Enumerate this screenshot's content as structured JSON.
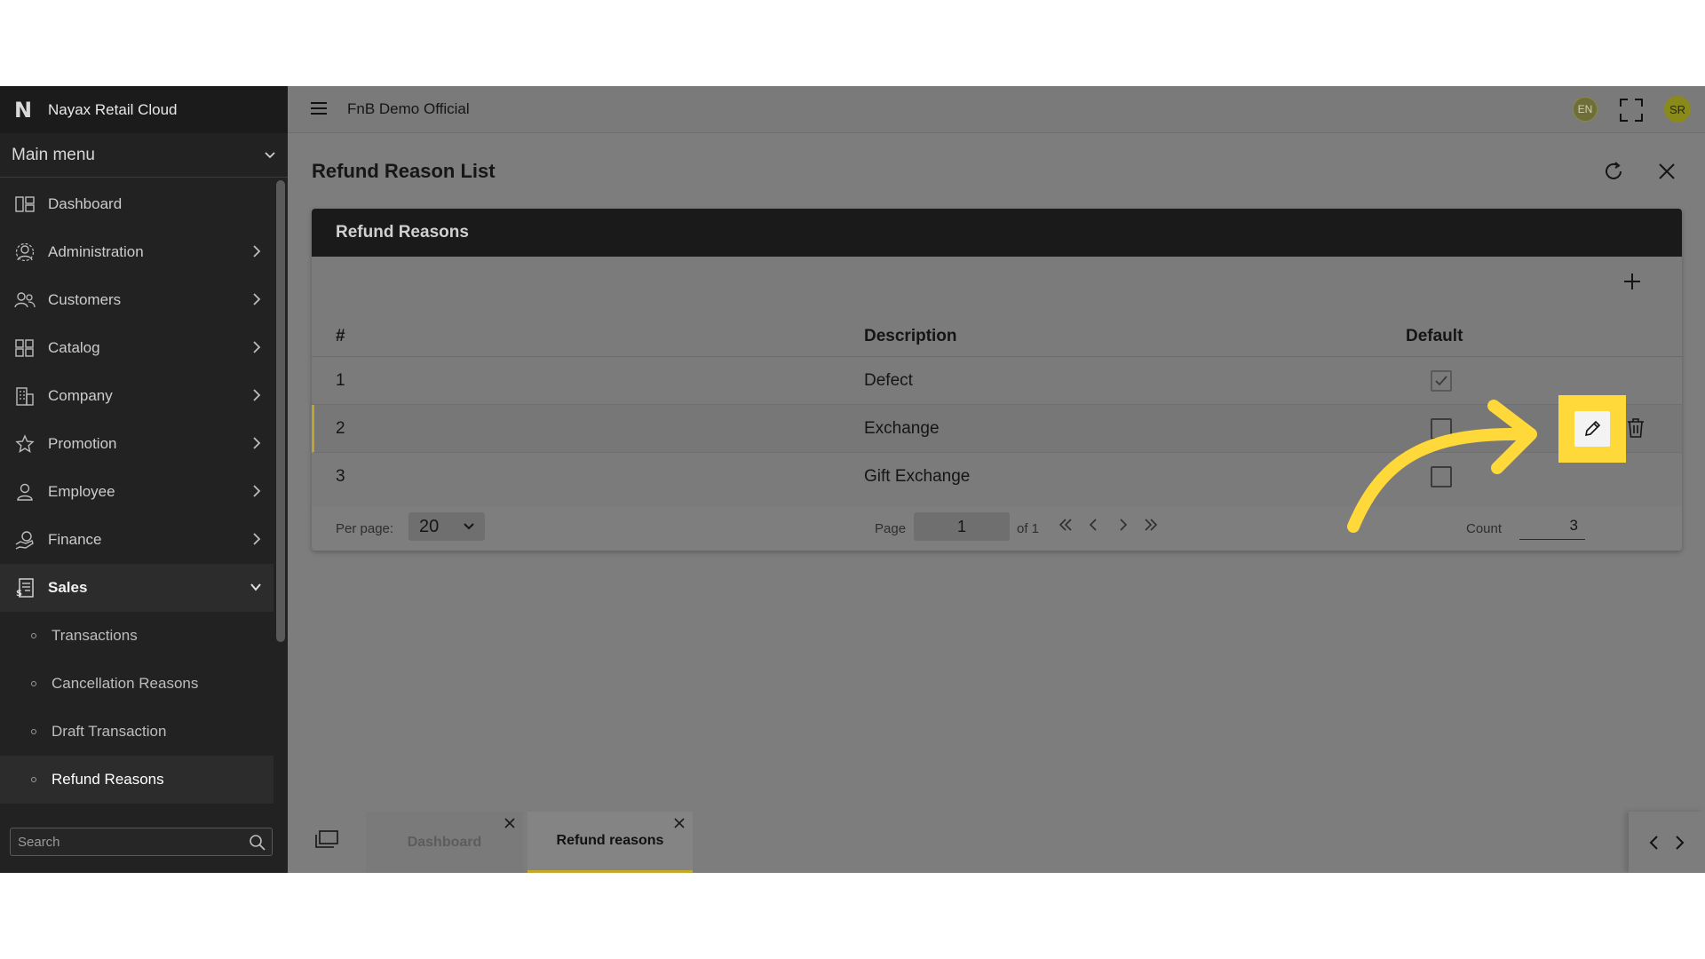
{
  "app": {
    "name": "Nayax Retail Cloud",
    "logo_letter": "N"
  },
  "sidebar": {
    "main_menu_label": "Main menu",
    "items": [
      {
        "label": "Dashboard",
        "icon": "dashboard-icon",
        "has_children": false
      },
      {
        "label": "Administration",
        "icon": "gear-user-icon",
        "has_children": true
      },
      {
        "label": "Customers",
        "icon": "users-icon",
        "has_children": true
      },
      {
        "label": "Catalog",
        "icon": "grid-icon",
        "has_children": true
      },
      {
        "label": "Company",
        "icon": "building-icon",
        "has_children": true
      },
      {
        "label": "Promotion",
        "icon": "star-icon",
        "has_children": true
      },
      {
        "label": "Employee",
        "icon": "person-icon",
        "has_children": true
      },
      {
        "label": "Finance",
        "icon": "hand-money-icon",
        "has_children": true
      },
      {
        "label": "Sales",
        "icon": "sales-icon",
        "has_children": true,
        "expanded": true
      }
    ],
    "sales_children": [
      "Transactions",
      "Cancellation Reasons",
      "Draft Transaction",
      "Refund Reasons"
    ],
    "search_placeholder": "Search"
  },
  "topbar": {
    "company": "FnB Demo Official",
    "lang": "EN",
    "avatar_initials": "SR"
  },
  "page": {
    "title": "Refund Reason List",
    "panel_title": "Refund Reasons",
    "columns": {
      "num": "#",
      "description": "Description",
      "default": "Default"
    },
    "rows": [
      {
        "num": "1",
        "description": "Defect",
        "default": true
      },
      {
        "num": "2",
        "description": "Exchange",
        "default": false
      },
      {
        "num": "3",
        "description": "Gift Exchange",
        "default": false
      }
    ],
    "pager": {
      "per_page_label": "Per page:",
      "per_page_value": "20",
      "page_label": "Page",
      "page_value": "1",
      "of_label": "of 1",
      "count_label": "Count",
      "count_value": "3"
    }
  },
  "tabs": [
    {
      "label": "Dashboard",
      "active": false
    },
    {
      "label": "Refund reasons",
      "active": true
    }
  ],
  "colors": {
    "highlight": "#ffd83a",
    "accent": "#c7a92a",
    "sidebar_bg": "#222222"
  }
}
